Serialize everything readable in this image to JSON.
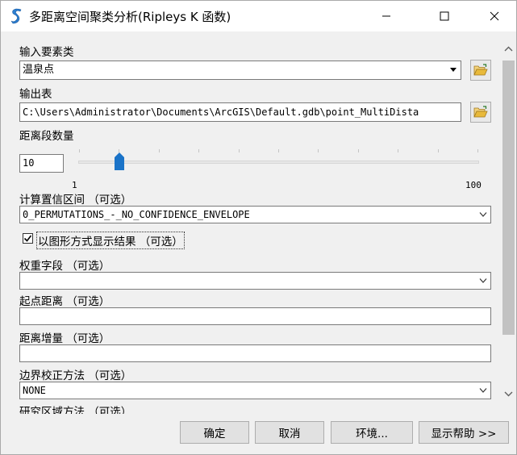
{
  "window": {
    "title": "多距离空间聚类分析(Ripleys K 函数)"
  },
  "form": {
    "input_features": {
      "label": "输入要素类",
      "value": "温泉点"
    },
    "output_table": {
      "label": "输出表",
      "value": "C:\\Users\\Administrator\\Documents\\ArcGIS\\Default.gdb\\point_MultiDista"
    },
    "distance_bands": {
      "label": "距离段数量",
      "value": "10",
      "min_label": "1",
      "max_label": "100"
    },
    "confidence": {
      "label": "计算置信区间 （可选）",
      "value": "0_PERMUTATIONS_-_NO_CONFIDENCE_ENVELOPE"
    },
    "display_results": {
      "label": "以图形方式显示结果 （可选）",
      "checked": true
    },
    "weight_field": {
      "label": "权重字段 （可选）",
      "value": ""
    },
    "begin_distance": {
      "label": "起点距离 （可选）",
      "value": ""
    },
    "distance_increment": {
      "label": "距离增量 （可选）",
      "value": ""
    },
    "boundary_correction": {
      "label": "边界校正方法 （可选）",
      "value": "NONE"
    },
    "study_area_method": {
      "label": "研究区域方法 （可选）"
    }
  },
  "buttons": {
    "ok": "确定",
    "cancel": "取消",
    "environments": "环境...",
    "show_help": "显示帮助 >>"
  },
  "icons": {
    "app": "arcgis-toolbox-icon",
    "browse": "folder-open-icon"
  },
  "colors": {
    "slider_thumb": "#1a73c8",
    "folder": "#e8b93a"
  }
}
